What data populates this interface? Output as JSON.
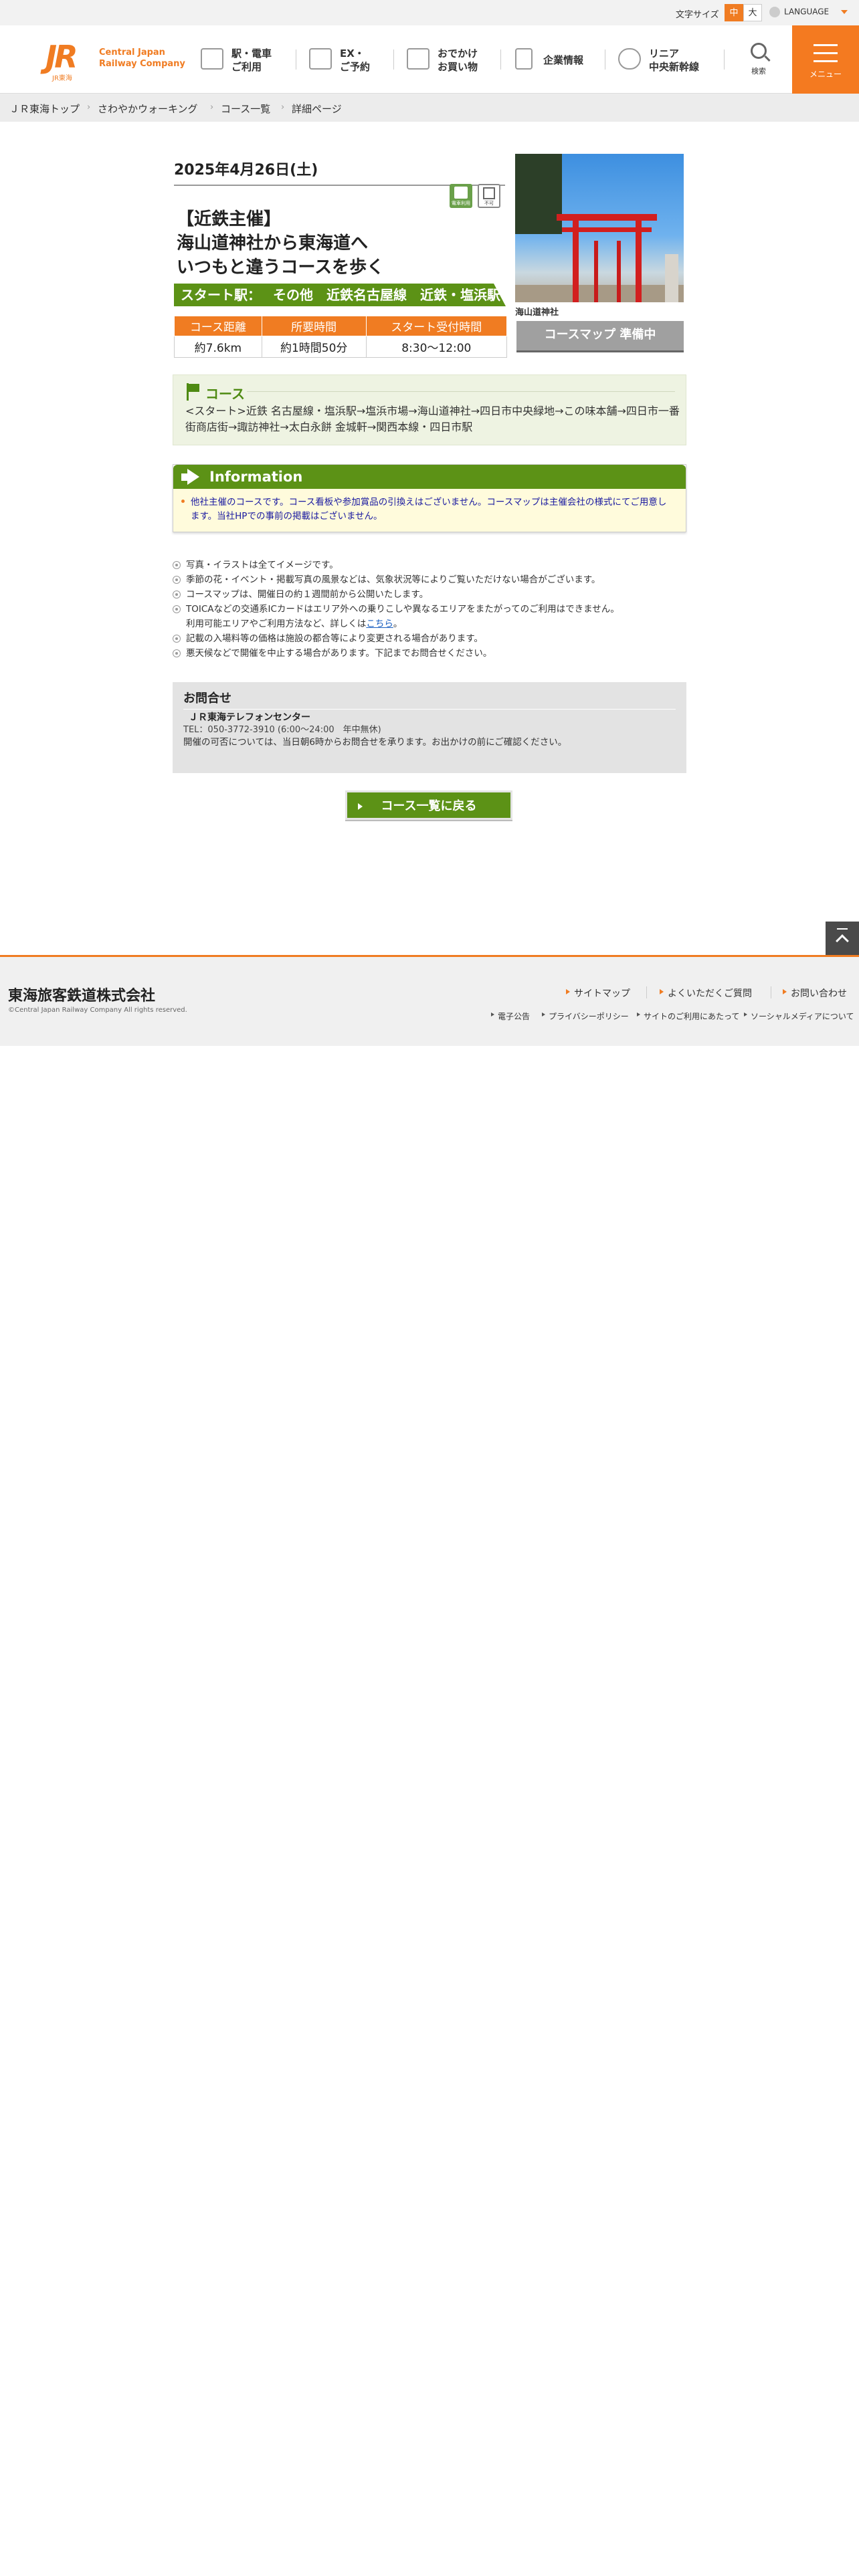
{
  "util": {
    "font_size_label": "文字サイズ",
    "font_mid": "中",
    "font_big": "大",
    "language": "LANGUAGE"
  },
  "logo": {
    "mark": "JR",
    "sub": "JR東海",
    "en_line1": "Central Japan",
    "en_line2": "Railway Company"
  },
  "nav": [
    {
      "label": "駅・電車\nご利用",
      "icon": "train-station-icon"
    },
    {
      "label": "EX・\nご予約",
      "icon": "ex-reserve-icon"
    },
    {
      "label": "おでかけ\nお買い物",
      "icon": "shopping-icon"
    },
    {
      "label": "企業情報",
      "icon": "building-icon"
    },
    {
      "label": "リニア\n中央新幹線",
      "icon": "linear-train-icon"
    }
  ],
  "search_label": "検索",
  "menu_label": "メニュー",
  "breadcrumb": [
    "ＪＲ東海トップ",
    "さわやかウォーキング",
    "コース一覧",
    "詳細ページ"
  ],
  "event": {
    "date": "2025年4月26日(土)",
    "badge1": "電車利用",
    "badge2": "不可",
    "title_line1": "【近鉄主催】",
    "title_line2": "海山道神社から東海道へ",
    "title_line3": "いつもと違うコースを歩く",
    "start_label": "スタート駅：",
    "start_value": "その他　近鉄名古屋線　近鉄・塩浜駅",
    "table_headers": [
      "コース距離",
      "所要時間",
      "スタート受付時間"
    ],
    "table_values": [
      "約7.6km",
      "約1時間50分",
      "8:30～12:00"
    ],
    "photo_caption": "海山道神社",
    "map_button": "コースマップ 準備中"
  },
  "course": {
    "heading": "コース",
    "text": "<スタート>近鉄 名古屋線・塩浜駅→塩浜市場→海山道神社→四日市中央緑地→この味本舗→四日市一番街商店街→諏訪神社→太白永餅 金城軒→関西本線・四日市駅"
  },
  "information": {
    "heading": "Information",
    "text": "他社主催のコースです。コース看板や参加賞品の引換えはございません。コースマップは主催会社の様式にてご用意します。当社HPでの事前の掲載はございません。"
  },
  "notes": [
    "写真・イラストは全てイメージです。",
    "季節の花・イベント・掲載写真の風景などは、気象状況等によりご覧いただけない場合がございます。",
    "コースマップは、開催日の約１週間前から公開いたします。",
    "TOICAなどの交通系ICカードはエリア外への乗りこしや異なるエリアをまたがってのご利用はできません。",
    "記載の入場料等の価格は施設の都合等により変更される場合があります。",
    "悪天候などで開催を中止する場合があります。下記までお問合せください。"
  ],
  "note_ic_line2": "利用可能エリアやご利用方法など、詳しくは",
  "note_ic_link": "こちら",
  "note_ic_end": "。",
  "contact": {
    "heading": "お問合せ",
    "name": "ＪＲ東海テレフォンセンター",
    "tel": "TEL：050-3772-3910 (6:00～24:00　年中無休)",
    "note": "開催の可否については、当日朝6時からお問合せを承ります。お出かけの前にご確認ください。"
  },
  "back_button": "コース一覧に戻る",
  "footer": {
    "company": "東海旅客鉄道株式会社",
    "copyright": "©Central Japan Railway Company All rights reserved.",
    "links": [
      "サイトマップ",
      "よくいただくご質問",
      "お問い合わせ"
    ],
    "sublinks": [
      "電子公告",
      "プライバシーポリシー",
      "サイトのご利用にあたって",
      "ソーシャルメディアについて"
    ]
  },
  "colors": {
    "brand_orange": "#f07c22",
    "accent_green": "#5c9216"
  }
}
